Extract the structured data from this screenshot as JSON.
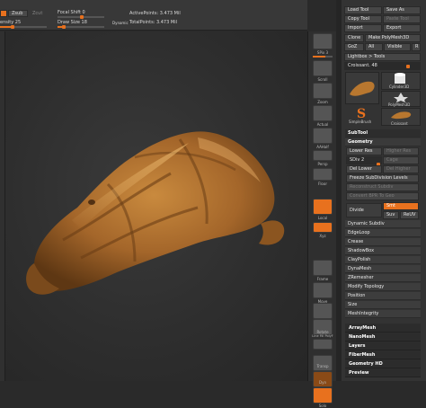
{
  "topbar": {
    "zsub_label": "Zsub",
    "zcut_label": "Zcut",
    "focal_shift_label": "Focal Shift",
    "focal_shift_value": "0",
    "intensity_label": "ensity",
    "intensity_value": "25",
    "draw_size_label": "Draw Size",
    "draw_size_value": "18",
    "dynamic_label": "Dynamic",
    "active_points": "ActivePoints: 3.473 Mil",
    "total_points": "TotalPoints: 3.473 Mil"
  },
  "right_toolbar": {
    "items": [
      {
        "label": "SPix 3"
      },
      {
        "label": "Scroll"
      },
      {
        "label": "Zoom"
      },
      {
        "label": "Actual"
      },
      {
        "label": "AAHalf"
      },
      {
        "label": "Persp"
      },
      {
        "label": "Floor"
      },
      {
        "label": "Local"
      },
      {
        "label": "Xyz"
      },
      {
        "label": "Frame"
      },
      {
        "label": "Move"
      },
      {
        "label": "Scale"
      },
      {
        "label": "Rotate"
      },
      {
        "label": "Line Fill PolyF"
      },
      {
        "label": "Transp"
      },
      {
        "label": "Dyn"
      },
      {
        "label": "Solo"
      }
    ]
  },
  "tool_panel": {
    "load_tool": "Load Tool",
    "save_as": "Save As",
    "copy_tool": "Copy Tool",
    "paste_tool": "Paste Tool",
    "import": "Import",
    "export": "Export",
    "clone": "Clone",
    "make_polymesh": "Make PolyMesh3D",
    "goz": "GoZ",
    "all": "All",
    "visible": "Visible",
    "r": "R",
    "lightbox_tools": "Lightbox > Tools",
    "current_tool": "Croissant. 48",
    "thumbs": [
      {
        "label": "Cylinder3D"
      },
      {
        "label": "PolyMesh3D"
      },
      {
        "label": "SimpleBrush"
      },
      {
        "label": "Croissant"
      }
    ]
  },
  "subtool_panel": {
    "subtool": "SubTool",
    "geometry": "Geometry",
    "lower_res": "Lower Res",
    "higher_res": "Higher Res",
    "sdiv": "SDiv 2",
    "cage": "Cage",
    "del_lower": "Del Lower",
    "del_higher": "Del Higher",
    "freeze_subdiv": "Freeze SubDivision Levels",
    "reconstruct_subdiv": "Reconstruct Subdiv",
    "convert_bpr": "Convert BPR To Geo",
    "divide": "Divide",
    "smt": "Smt",
    "suv": "Suv",
    "reuv": "ReUV",
    "dynamic_subdiv": "Dynamic Subdiv",
    "edgeloop": "EdgeLoop",
    "crease": "Crease",
    "shadowbox": "ShadowBox",
    "claypolish": "ClayPolish",
    "dynamesh": "DynaMesh",
    "zremesher": "ZRemesher",
    "modify_topology": "Modify Topology",
    "position": "Position",
    "size": "Size",
    "meshintegrity": "MeshIntegrity"
  },
  "sections": [
    {
      "label": "ArrayMesh"
    },
    {
      "label": "NanoMesh"
    },
    {
      "label": "Layers"
    },
    {
      "label": "FiberMesh"
    },
    {
      "label": "Geometry HD"
    },
    {
      "label": "Preview"
    }
  ],
  "colors": {
    "accent": "#e8711e",
    "panel": "#333333",
    "viewport": "#2e2e2e"
  },
  "sliders": {
    "focal_shift": 0,
    "intensity": 25,
    "draw_size": 18
  }
}
